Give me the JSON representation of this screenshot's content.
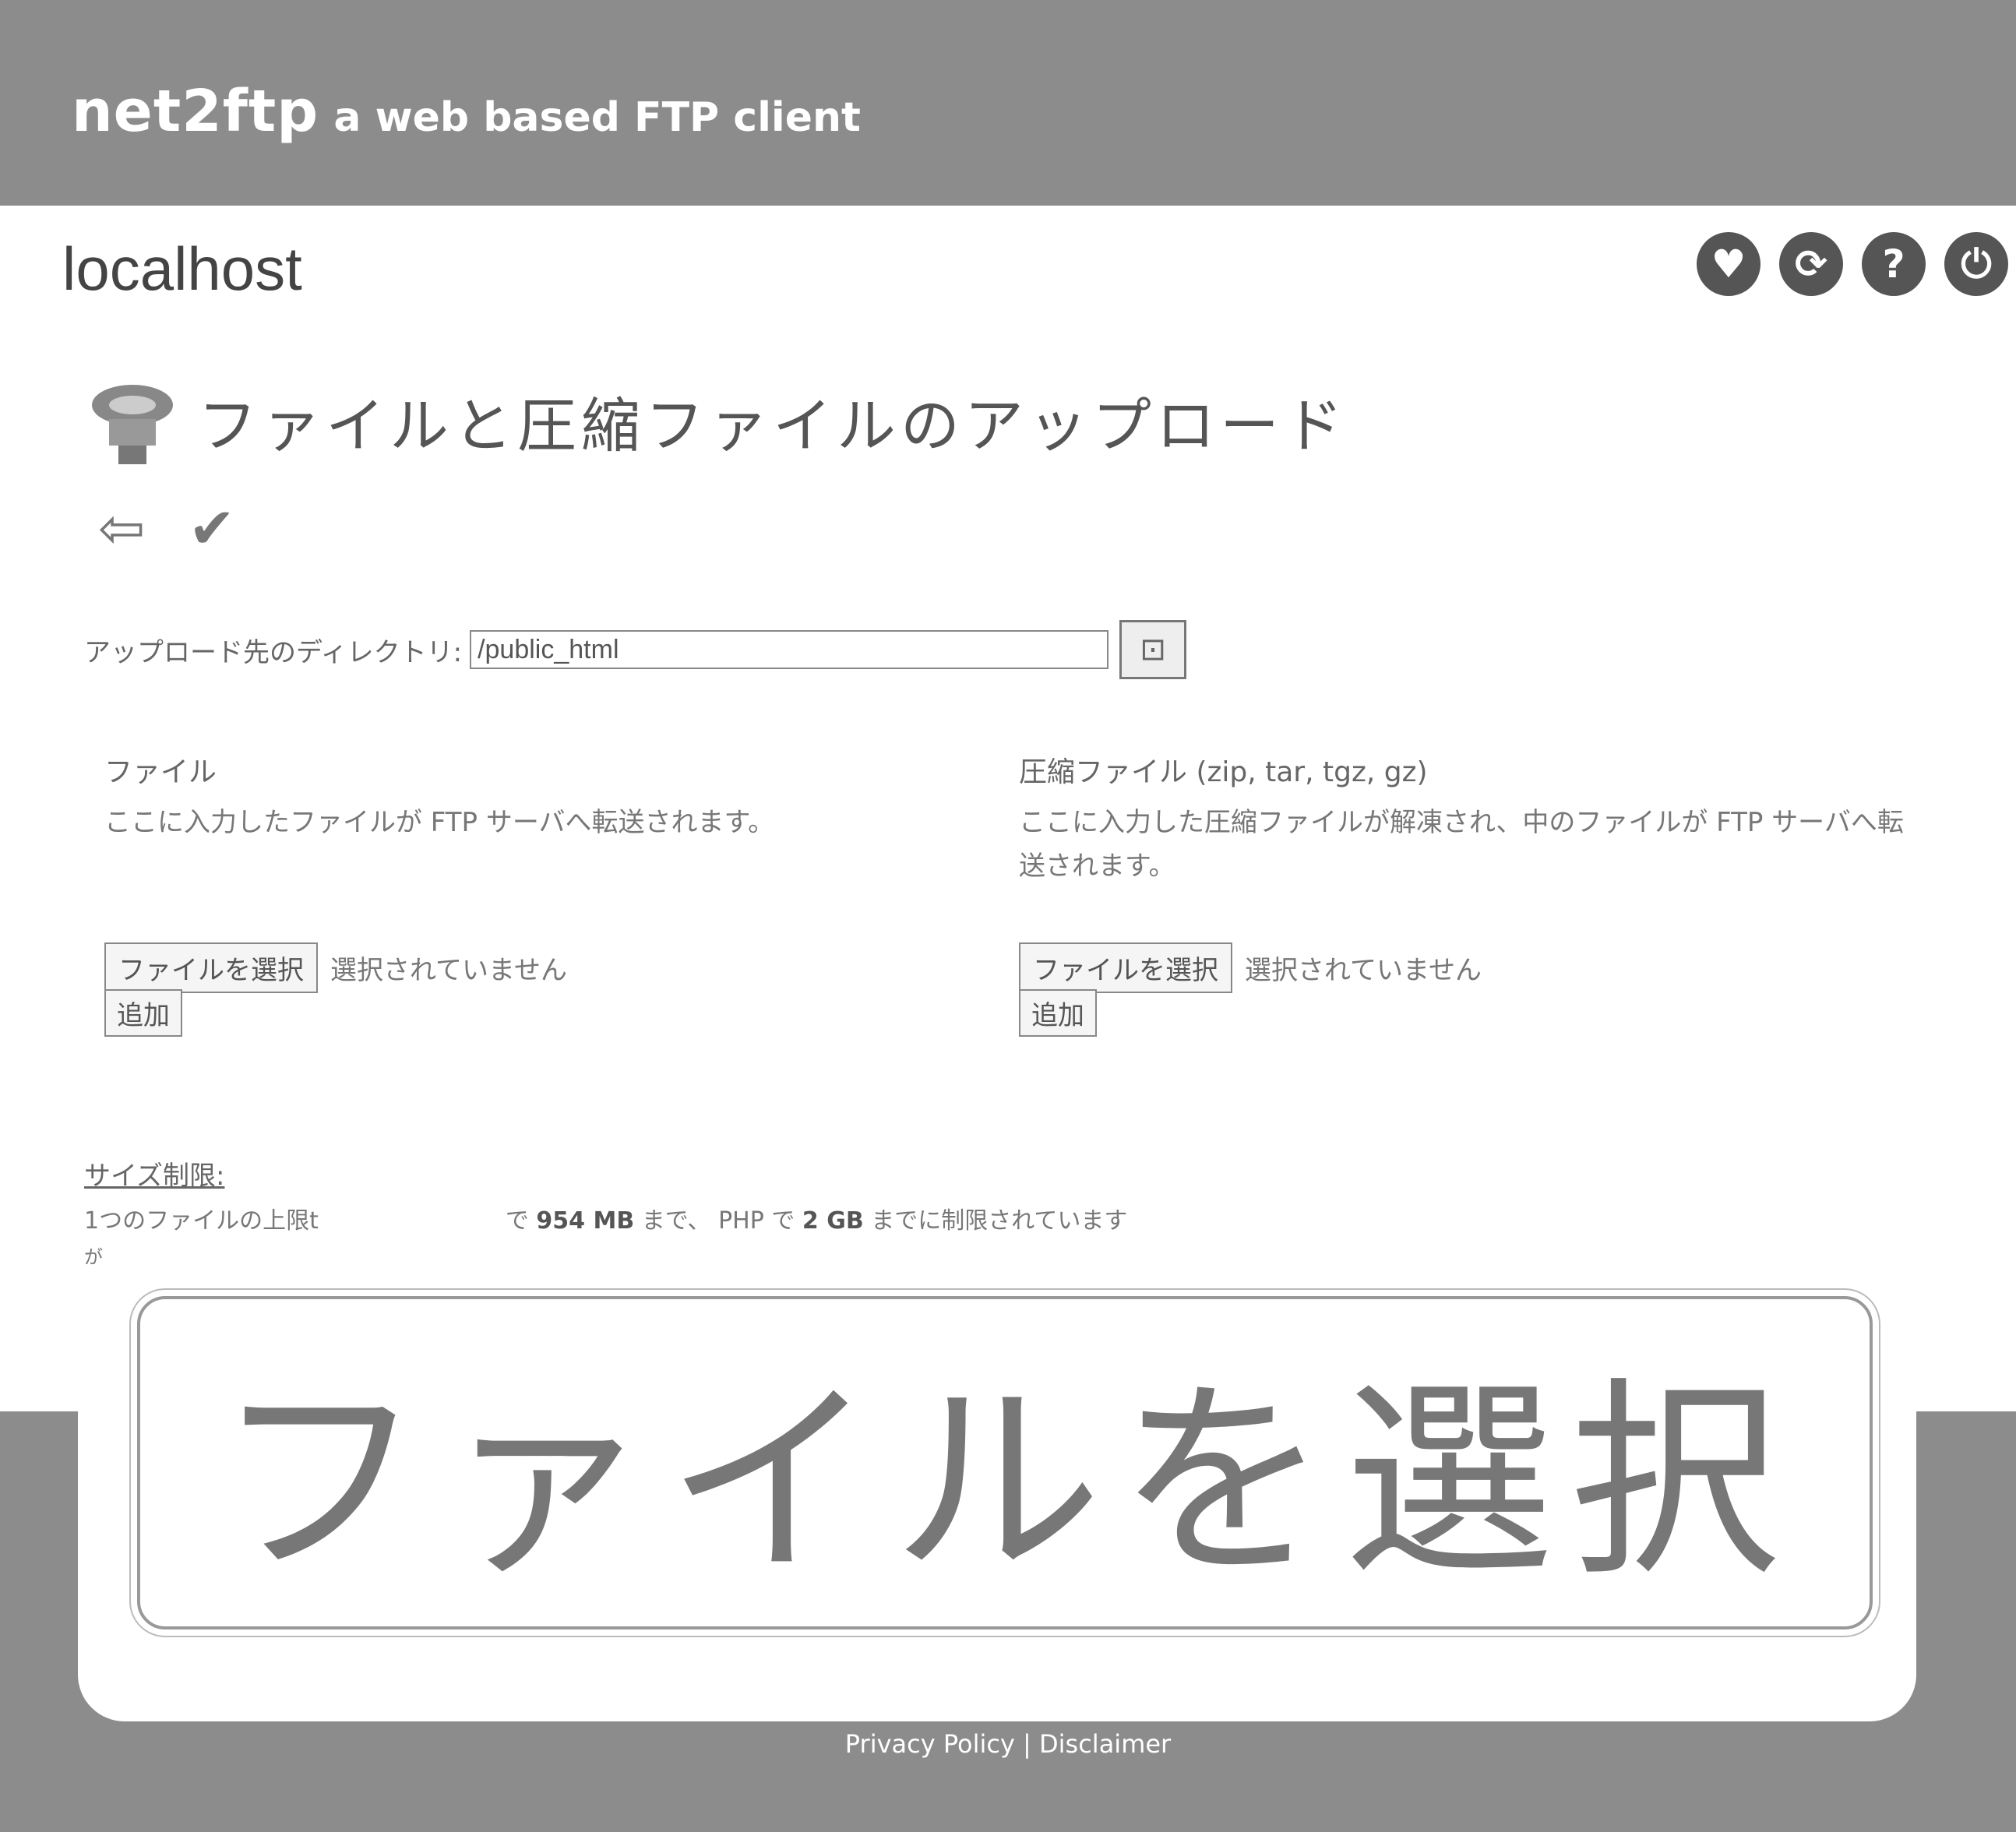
{
  "header": {
    "brand_name": "net2ftp",
    "brand_tagline": "a web based FTP client"
  },
  "host": "localhost",
  "top_icons": [
    "bookmark-icon",
    "refresh-icon",
    "help-icon",
    "logout-icon"
  ],
  "page": {
    "title": "ファイルと圧縮ファイルのアップロード"
  },
  "directory": {
    "label": "アップロード先のディレクトリ:",
    "value": "/public_html"
  },
  "files_section": {
    "title": "ファイル",
    "description": "ここに入力したファイルが FTP サーバへ転送されます。",
    "choose_label": "ファイルを選択",
    "no_file_text": "選択されていません",
    "add_label": "追加"
  },
  "archives_section": {
    "title": "圧縮ファイル (zip, tar, tgz, gz)",
    "description": "ここに入力した圧縮ファイルが解凍され、中のファイルが FTP サーバへ転送されます。",
    "choose_label": "ファイルを選択",
    "no_file_text": "選択されていません",
    "add_label": "追加"
  },
  "size_limits": {
    "heading": "サイズ制限:",
    "text_before": "1つのファイルの上限t",
    "text_after_prefix": "で",
    "limit_1": "954 MB",
    "mid_text": "まで、 PHP で",
    "limit_2": "2 GB",
    "end_text": "までに制限されています",
    "fragment": "が"
  },
  "overlay": {
    "label": "ファイルを選択"
  },
  "footer": {
    "privacy": "Privacy Policy",
    "separator": "|",
    "disclaimer": "Disclaimer"
  }
}
